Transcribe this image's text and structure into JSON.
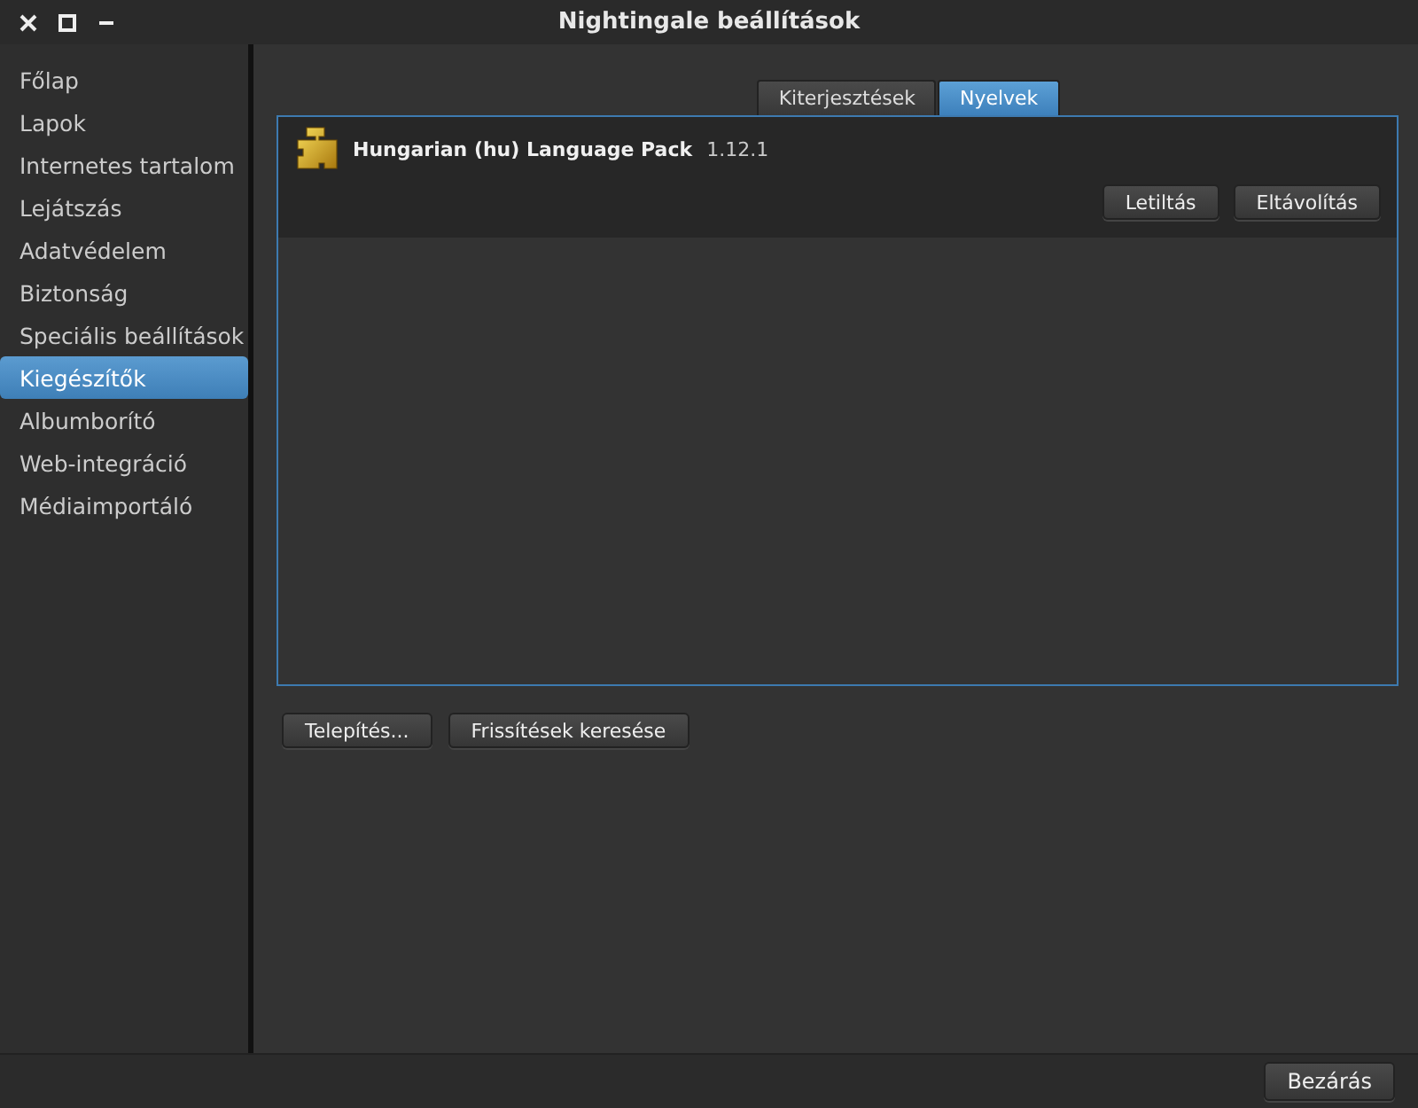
{
  "window": {
    "title": "Nightingale beállítások"
  },
  "sidebar": {
    "items": [
      {
        "label": "Főlap",
        "selected": false
      },
      {
        "label": "Lapok",
        "selected": false
      },
      {
        "label": "Internetes tartalom",
        "selected": false
      },
      {
        "label": "Lejátszás",
        "selected": false
      },
      {
        "label": "Adatvédelem",
        "selected": false
      },
      {
        "label": "Biztonság",
        "selected": false
      },
      {
        "label": "Speciális beállítások",
        "selected": false
      },
      {
        "label": "Kiegészítők",
        "selected": true
      },
      {
        "label": "Albumborító",
        "selected": false
      },
      {
        "label": "Web-integráció",
        "selected": false
      },
      {
        "label": "Médiaimportáló",
        "selected": false
      }
    ]
  },
  "tabs": [
    {
      "label": "Kiterjesztések",
      "selected": false
    },
    {
      "label": "Nyelvek",
      "selected": true
    }
  ],
  "addons": [
    {
      "name": "Hungarian (hu) Language Pack",
      "version": "1.12.1",
      "buttons": [
        "Letiltás",
        "Eltávolítás"
      ]
    }
  ],
  "actions": [
    "Telepítés...",
    "Frissítések keresése"
  ],
  "footer": {
    "buttons": [
      "Bezárás"
    ]
  }
}
